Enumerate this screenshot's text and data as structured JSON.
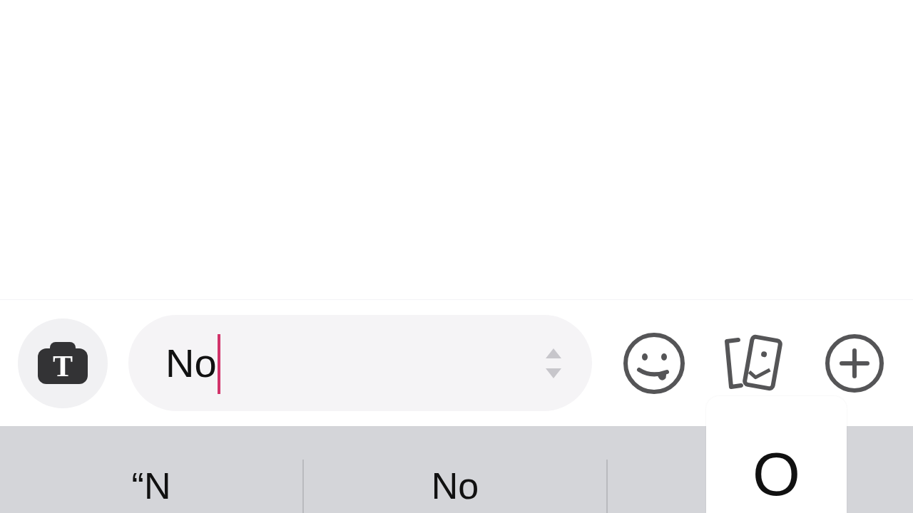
{
  "text_style_button": {
    "glyph": "T"
  },
  "message_field": {
    "value": "No",
    "focused": true
  },
  "suggestions": [
    {
      "label": "“N"
    },
    {
      "label": "No"
    }
  ],
  "key_preview": {
    "label": "O"
  }
}
